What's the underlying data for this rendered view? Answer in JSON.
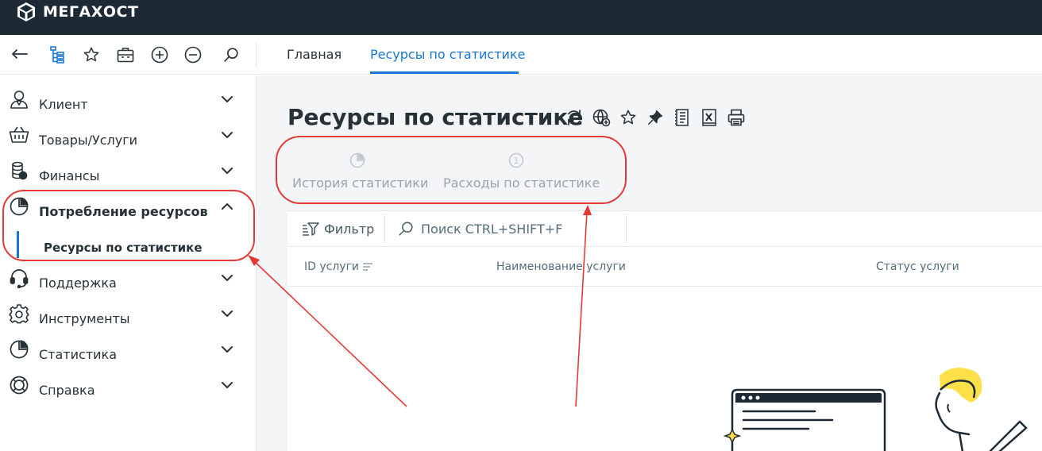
{
  "app": {
    "brand": "МЕГАХОСТ"
  },
  "nav_tabs": [
    {
      "label": "Главная",
      "active": false
    },
    {
      "label": "Ресурсы по статистике",
      "active": true
    }
  ],
  "toolbar_icons": [
    "back-arrow-icon",
    "tree-icon",
    "star-icon",
    "briefcase-icon",
    "plus-circle-icon",
    "minus-circle-icon",
    "search-icon"
  ],
  "sidebar": {
    "items": [
      {
        "label": "Клиент",
        "icon": "user-icon"
      },
      {
        "label": "Товары/Услуги",
        "icon": "cart-icon"
      },
      {
        "label": "Финансы",
        "icon": "coins-icon"
      },
      {
        "label": "Потребление ресурсов",
        "icon": "pie-chart-icon",
        "expanded": true
      },
      {
        "label": "Поддержка",
        "icon": "headset-icon"
      },
      {
        "label": "Инструменты",
        "icon": "gear-icon"
      },
      {
        "label": "Статистика",
        "icon": "pie-chart-icon"
      },
      {
        "label": "Справка",
        "icon": "lifebuoy-icon"
      }
    ],
    "subitem": {
      "label": "Ресурсы по статистике"
    }
  },
  "main": {
    "title": "Ресурсы по статистике",
    "title_icons": [
      "refresh-icon",
      "globe-icon",
      "star-icon",
      "pin-icon",
      "list-icon",
      "excel-icon",
      "print-icon"
    ],
    "sub_tabs": [
      {
        "label": "История статистики",
        "icon": "pie-chart-icon"
      },
      {
        "label": "Расходы по статистике",
        "icon": "numbered-circle-icon",
        "icon_text": "1"
      }
    ],
    "filter_label": "Фильтр",
    "search_placeholder": "Поиск CTRL+SHIFT+F",
    "columns": [
      "ID услуги",
      "Наименование услуги",
      "Статус услуги"
    ]
  },
  "colors": {
    "topbar": "#1d2a36",
    "accent": "#1976d2",
    "annotation": "#e53935",
    "illustration_yellow": "#fde047"
  }
}
